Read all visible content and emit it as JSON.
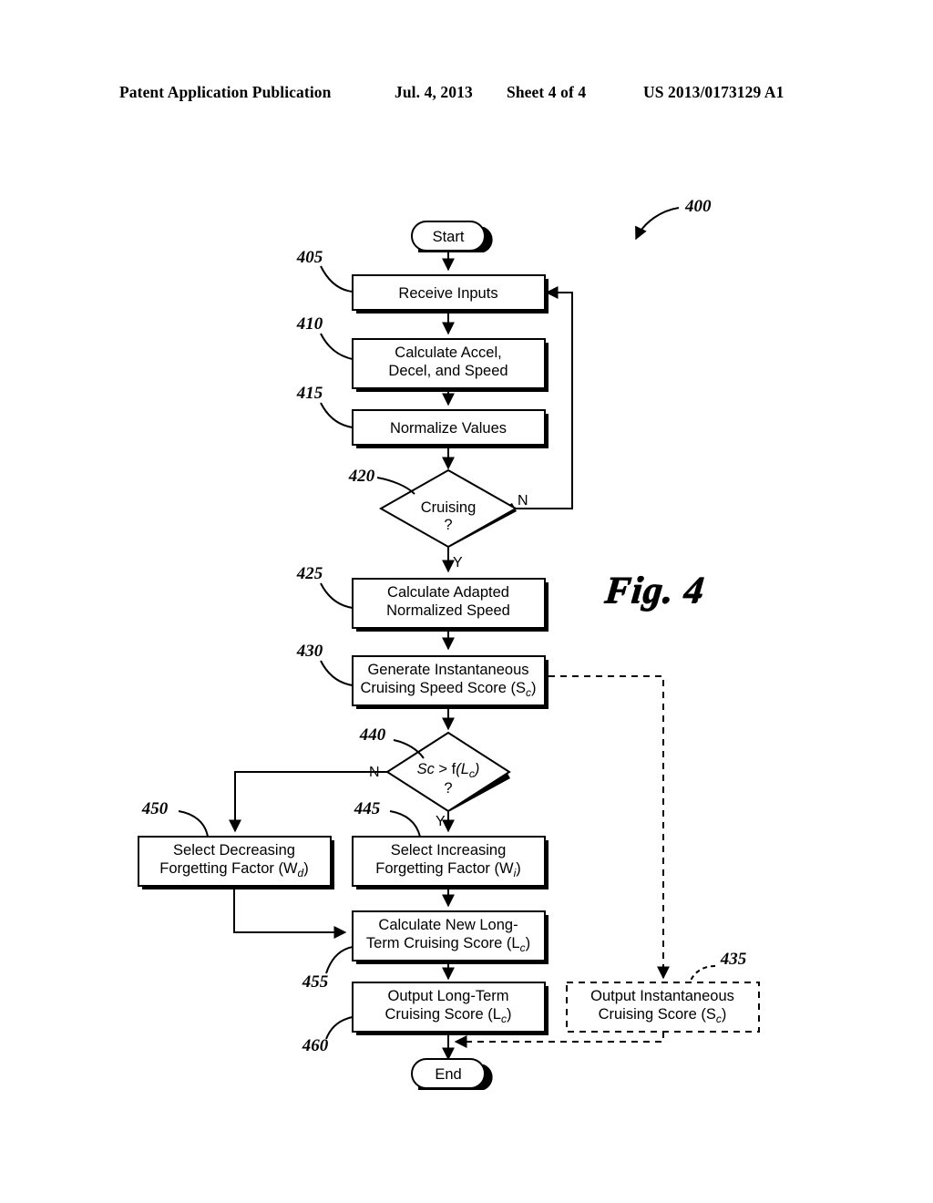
{
  "header": {
    "publication": "Patent Application Publication",
    "date": "Jul. 4, 2013",
    "sheet": "Sheet 4 of 4",
    "number": "US 2013/0173129 A1"
  },
  "figure": {
    "caption": "Fig. 4",
    "diagram_ref": "400"
  },
  "flowchart": {
    "terminators": [
      {
        "id": "start",
        "label": "Start"
      },
      {
        "id": "end",
        "label": "End"
      }
    ],
    "nodes": [
      {
        "ref": "405",
        "id": "receive-inputs",
        "line1": "Receive Inputs",
        "line2": ""
      },
      {
        "ref": "410",
        "id": "calculate-accel",
        "line1": "Calculate Accel,",
        "line2": "Decel, and Speed"
      },
      {
        "ref": "415",
        "id": "normalize-values",
        "line1": "Normalize Values",
        "line2": ""
      },
      {
        "ref": "425",
        "id": "calculate-adapted-speed",
        "line1": "Calculate Adapted",
        "line2": "Normalized Speed"
      },
      {
        "ref": "430",
        "id": "generate-instantaneous-score",
        "line1": "Generate Instantaneous",
        "line2": "Cruising Speed Score (S",
        "sub": "c",
        "line2_tail": ")"
      },
      {
        "ref": "450",
        "id": "select-decreasing-factor",
        "line1": "Select Decreasing",
        "line2": "Forgetting Factor (W",
        "sub": "d",
        "line2_tail": ")"
      },
      {
        "ref": "445",
        "id": "select-increasing-factor",
        "line1": "Select Increasing",
        "line2": "Forgetting Factor (W",
        "sub": "i",
        "line2_tail": ")"
      },
      {
        "ref": "455",
        "id": "calculate-new-long-term-score",
        "line1": "Calculate New Long-",
        "line2": "Term Cruising Score (L",
        "sub": "c",
        "line2_tail": ")"
      },
      {
        "ref": "460",
        "id": "output-long-term-score",
        "line1": "Output Long-Term",
        "line2": "Cruising Score (L",
        "sub": "c",
        "line2_tail": ")"
      },
      {
        "ref": "435",
        "id": "output-instantaneous-score",
        "line1": "Output Instantaneous",
        "line2": "Cruising Score (S",
        "sub": "c",
        "line2_tail": ")",
        "dashed": true
      }
    ],
    "decisions": [
      {
        "ref": "420",
        "id": "cruising-decision",
        "line1": "Cruising",
        "line2": "?",
        "yes_label": "Y",
        "no_label": "N"
      },
      {
        "ref": "440",
        "id": "score-threshold-decision",
        "line1_a": "Sc",
        "line1_b": " > f",
        "line1_c": "(L",
        "line1_sub": "c",
        "line1_d": ")",
        "line2": "?",
        "yes_label": "Y",
        "no_label": "N"
      }
    ]
  }
}
